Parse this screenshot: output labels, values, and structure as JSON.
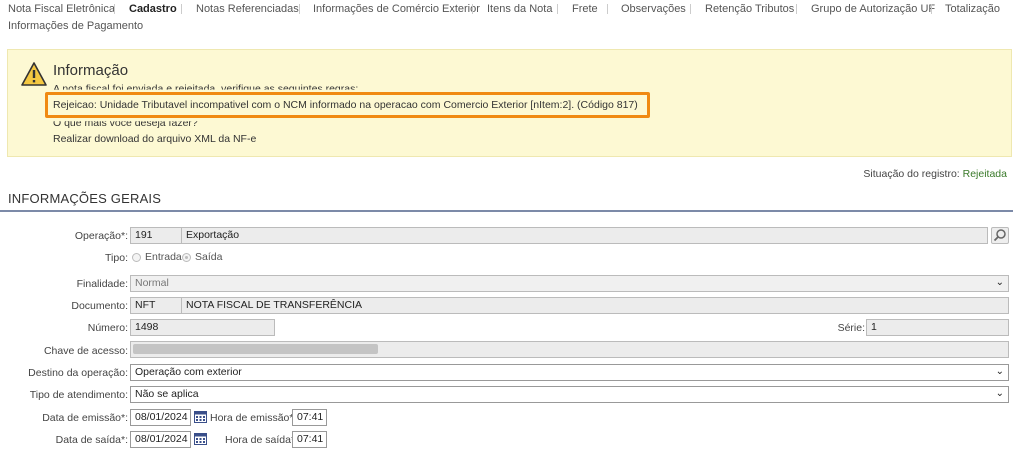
{
  "tabs": {
    "row1": [
      "Nota Fiscal Eletrônica",
      "Cadastro",
      "Notas Referenciadas",
      "Informações de Comércio Exterior",
      "Itens da Nota",
      "Frete",
      "Observações",
      "Retenção Tributos",
      "Grupo de Autorização UF",
      "Totalização"
    ],
    "row2": [
      "Informações de Pagamento"
    ]
  },
  "info": {
    "title": "Informação",
    "line1": "A nota fiscal foi enviada e rejeitada, verifique as seguintes regras:",
    "error": "Rejeicao: Unidade Tributavel incompativel com o NCM informado na operacao com Comercio Exterior [nItem:2]. (Código 817)",
    "question": "O que mais você deseja fazer?",
    "download_link": "Realizar download do arquivo XML da NF-e"
  },
  "status": {
    "label": "Situação do registro:",
    "value": "Rejeitada"
  },
  "section_title": "INFORMAÇÕES GERAIS",
  "form": {
    "operacao": {
      "label": "Operação*:",
      "code": "191",
      "name": "Exportação"
    },
    "tipo": {
      "label": "Tipo:",
      "option1": "Entrada",
      "option2": "Saída"
    },
    "finalidade": {
      "label": "Finalidade:",
      "value": "Normal"
    },
    "documento": {
      "label": "Documento:",
      "code": "NFT",
      "name": "NOTA FISCAL DE TRANSFERÊNCIA"
    },
    "numero": {
      "label": "Número:",
      "value": "1498"
    },
    "serie": {
      "label": "Série:",
      "value": "1"
    },
    "chave": {
      "label": "Chave de acesso:"
    },
    "destino": {
      "label": "Destino da operação:",
      "value": "Operação com exterior"
    },
    "atendimento": {
      "label": "Tipo de atendimento:",
      "value": "Não se aplica"
    },
    "data_emissao": {
      "label": "Data de emissão*:",
      "value": "08/01/2024"
    },
    "hora_emissao": {
      "label": "Hora de emissão*:",
      "value": "07:41"
    },
    "data_saida": {
      "label": "Data de saída*:",
      "value": "08/01/2024"
    },
    "hora_saida": {
      "label": "Hora de saída*:",
      "value": "07:41"
    }
  },
  "colors": {
    "highlight": "#f08a12",
    "info_bg": "#fdf9d3",
    "status_ok": "#3a7a2a"
  }
}
